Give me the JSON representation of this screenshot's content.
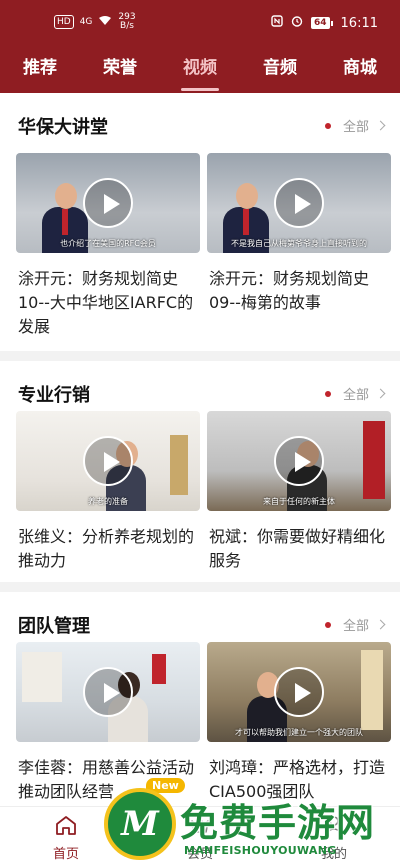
{
  "status_bar": {
    "badge": "HD",
    "network": "4G",
    "speed_value": "293",
    "speed_unit": "B/s",
    "battery": "64",
    "time": "16:11"
  },
  "tabs": [
    {
      "label": "推荐",
      "active": false
    },
    {
      "label": "荣誉",
      "active": false
    },
    {
      "label": "视频",
      "active": true
    },
    {
      "label": "音频",
      "active": false
    },
    {
      "label": "商城",
      "active": false
    }
  ],
  "sections": [
    {
      "title": "华保大讲堂",
      "more": "全部",
      "items": [
        {
          "caption": "也介绍了在美国的RFC会员",
          "title": "涂开元：财务规划简史10--大中华地区IARFC的发展"
        },
        {
          "caption": "不是我自己从梅第爷爷身上直接听到的",
          "title": "涂开元：财务规划简史09--梅第的故事"
        }
      ]
    },
    {
      "title": "专业行销",
      "more": "全部",
      "items": [
        {
          "caption": "养老的准备",
          "title": "张维义：分析养老规划的推动力"
        },
        {
          "caption": "来自于任何的新主体",
          "title": "祝斌：你需要做好精细化服务"
        }
      ]
    },
    {
      "title": "团队管理",
      "more": "全部",
      "items": [
        {
          "caption": "",
          "title": "李佳蓉：用慈善公益活动推动团队经营",
          "badge": "New"
        },
        {
          "caption": "才可以帮助我们建立一个强大的团队",
          "title": "刘鸿璋：严格选材，打造CIA500强团队"
        }
      ]
    }
  ],
  "bottom_nav": [
    {
      "label": "首页",
      "icon": "home-icon",
      "active": true
    },
    {
      "label": "会员",
      "icon": "member-icon",
      "active": false
    },
    {
      "label": "我的",
      "icon": "profile-icon",
      "active": false
    }
  ],
  "watermark": {
    "letter": "M",
    "text": "免费手游网",
    "url": "MANFEISHOUYOUWANG"
  },
  "colors": {
    "brand": "#8f1d22",
    "accent_dot": "#c0242c",
    "badge_new": "#f5b700",
    "watermark_green": "#1f8a3c"
  }
}
